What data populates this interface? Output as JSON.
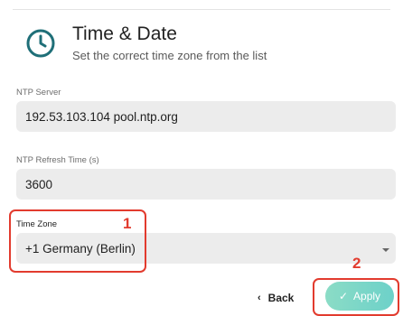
{
  "header": {
    "title": "Time & Date",
    "subtitle": "Set the correct time zone from the list",
    "icon": "clock-icon"
  },
  "fields": {
    "ntp_server": {
      "label": "NTP Server",
      "value": "192.53.103.104 pool.ntp.org"
    },
    "ntp_refresh": {
      "label": "NTP Refresh Time (s)",
      "value": "3600"
    },
    "time_zone": {
      "label": "Time Zone",
      "value": "+1 Germany (Berlin)"
    }
  },
  "annotations": {
    "one": "1",
    "two": "2"
  },
  "actions": {
    "back_label": "Back",
    "apply_label": "Apply",
    "back_icon": "chevron-left-icon",
    "apply_icon": "check-icon"
  },
  "colors": {
    "accent": "#6dd1c9",
    "annotation": "#e23b2e",
    "icon": "#1f6f78"
  }
}
